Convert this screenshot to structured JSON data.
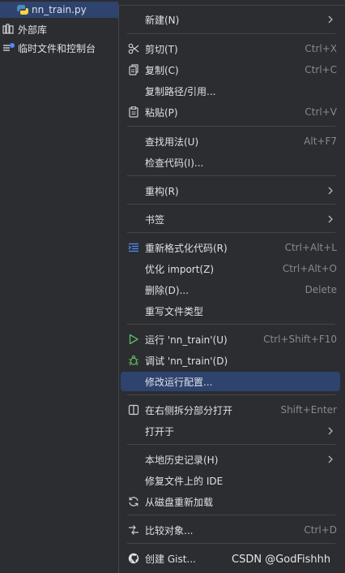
{
  "project_tree": {
    "file": "nn_train.py",
    "external_libraries": "外部库",
    "scratches": "临时文件和控制台"
  },
  "context_menu": {
    "new": {
      "label": "新建(N)"
    },
    "cut": {
      "label": "剪切(T)",
      "shortcut": "Ctrl+X",
      "icon": "scissors-icon"
    },
    "copy": {
      "label": "复制(C)",
      "shortcut": "Ctrl+C",
      "icon": "copy-icon"
    },
    "copy_path": {
      "label": "复制路径/引用..."
    },
    "paste": {
      "label": "粘贴(P)",
      "shortcut": "Ctrl+V",
      "icon": "paste-icon"
    },
    "find_usages": {
      "label": "查找用法(U)",
      "shortcut": "Alt+F7"
    },
    "inspect_code": {
      "label": "检查代码(I)..."
    },
    "refactor": {
      "label": "重构(R)"
    },
    "bookmarks": {
      "label": "书签"
    },
    "reformat_code": {
      "label": "重新格式化代码(R)",
      "shortcut": "Ctrl+Alt+L",
      "icon": "reformat-icon"
    },
    "optimize_imports": {
      "label": "优化 import(Z)",
      "shortcut": "Ctrl+Alt+O"
    },
    "delete": {
      "label": "删除(D)...",
      "shortcut": "Delete"
    },
    "override_file_type": {
      "label": "重写文件类型"
    },
    "run": {
      "label": "运行 'nn_train'(U)",
      "shortcut": "Ctrl+Shift+F10",
      "icon": "run-icon"
    },
    "debug": {
      "label": "调试 'nn_train'(D)",
      "icon": "debug-icon"
    },
    "modify_run_config": {
      "label": "修改运行配置..."
    },
    "open_right_split": {
      "label": "在右侧拆分部分打开",
      "shortcut": "Shift+Enter",
      "icon": "split-icon"
    },
    "open_in": {
      "label": "打开于"
    },
    "local_history": {
      "label": "本地历史记录(H)"
    },
    "repair_ide": {
      "label": "修复文件上的 IDE"
    },
    "reload_from_disk": {
      "label": "从磁盘重新加载",
      "icon": "reload-icon"
    },
    "compare_with": {
      "label": "比较对象...",
      "shortcut": "Ctrl+D",
      "icon": "compare-icon"
    },
    "create_gist": {
      "label": "创建 Gist...",
      "icon": "github-icon"
    }
  },
  "watermark": "CSDN @GodFishhh",
  "colors": {
    "background": "#2b2d30",
    "selection": "#2e436e",
    "separator": "#43454a",
    "shortcut": "#868991",
    "run_green": "#5fb865"
  }
}
